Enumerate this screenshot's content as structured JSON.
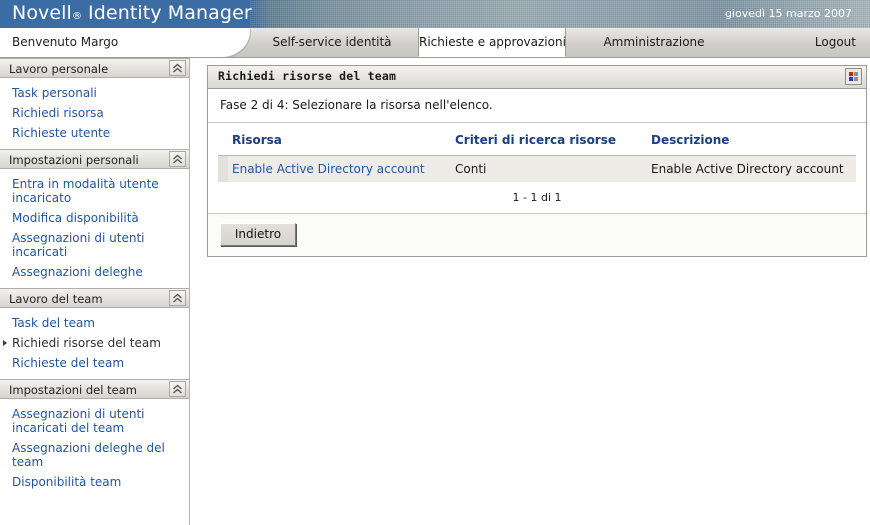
{
  "header": {
    "brand_name": "Novell",
    "brand_reg": "®",
    "product_name": "Identity Manager",
    "date": "giovedì 15 marzo 2007",
    "brand_blue": "#3c6ca4"
  },
  "nav": {
    "welcome": "Benvenuto Margo",
    "tabs": [
      {
        "label": "Self-service identità",
        "active": false
      },
      {
        "label": "Richieste e approvazioni",
        "active": true
      },
      {
        "label": "Amministrazione",
        "active": false
      }
    ],
    "logout": "Logout"
  },
  "sidebar": {
    "sections": [
      {
        "title": "Lavoro personale",
        "collapse_icon": "chevron-double-up-icon",
        "items": [
          {
            "label": "Task personali",
            "selected": false
          },
          {
            "label": "Richiedi risorsa",
            "selected": false
          },
          {
            "label": "Richieste utente",
            "selected": false
          }
        ]
      },
      {
        "title": "Impostazioni personali",
        "collapse_icon": "chevron-double-up-icon",
        "items": [
          {
            "label": "Entra in modalità utente incaricato",
            "selected": false
          },
          {
            "label": "Modifica disponibilità",
            "selected": false
          },
          {
            "label": "Assegnazioni di utenti incaricati",
            "selected": false
          },
          {
            "label": "Assegnazioni deleghe",
            "selected": false
          }
        ]
      },
      {
        "title": "Lavoro del team",
        "collapse_icon": "chevron-double-up-icon",
        "items": [
          {
            "label": "Task del team",
            "selected": false
          },
          {
            "label": "Richiedi risorse del team",
            "selected": true
          },
          {
            "label": "Richieste del team",
            "selected": false
          }
        ]
      },
      {
        "title": "Impostazioni del team",
        "collapse_icon": "chevron-double-up-icon",
        "items": [
          {
            "label": "Assegnazioni di utenti incaricati del team",
            "selected": false
          },
          {
            "label": "Assegnazioni deleghe del team",
            "selected": false
          },
          {
            "label": "Disponibilità team",
            "selected": false
          }
        ]
      }
    ]
  },
  "panel": {
    "title": "Richiedi risorse del team",
    "legend_icon": "color-legend-icon",
    "legend_colors": [
      "#cc2020",
      "#3a9e3a",
      "#8f8f8f",
      "#2040cc"
    ],
    "step_text": "Fase 2 di 4: Selezionare la risorsa nell'elenco.",
    "table": {
      "columns": [
        "Risorsa",
        "Criteri di ricerca risorse",
        "Descrizione"
      ],
      "rows": [
        {
          "risorsa": "Enable Active Directory account",
          "criteri": "Conti",
          "descrizione": "Enable Active Directory account"
        }
      ]
    },
    "pager": "1 - 1 di 1",
    "back_button": "Indietro"
  }
}
